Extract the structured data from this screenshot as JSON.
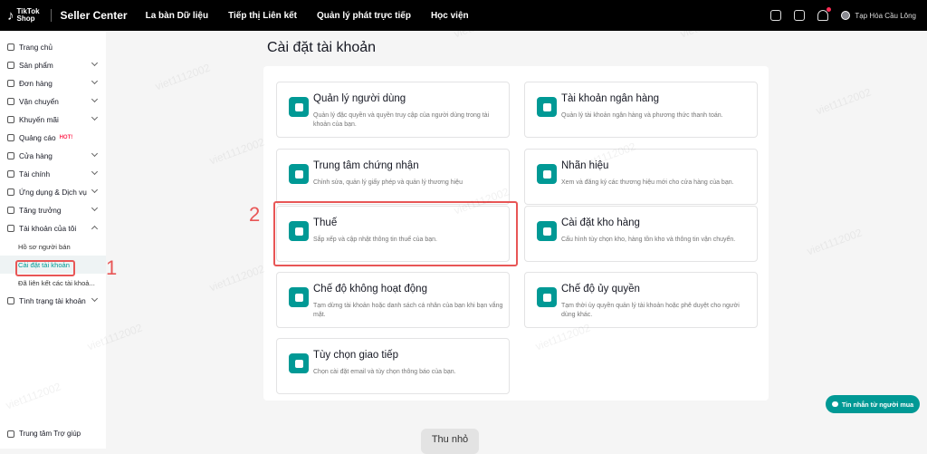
{
  "topbar": {
    "logo_line1": "TikTok",
    "logo_line2": "Shop",
    "seller_center": "Seller Center",
    "nav": [
      "La bàn Dữ liệu",
      "Tiếp thị Liên kết",
      "Quản lý phát trực tiếp",
      "Học viện"
    ],
    "user_name": "Tạp Hóa Cầu Lông"
  },
  "sidebar": {
    "items": [
      {
        "label": "Trang chủ",
        "icon": "home-icon"
      },
      {
        "label": "Sản phẩm",
        "icon": "product-icon"
      },
      {
        "label": "Đơn hàng",
        "icon": "order-icon"
      },
      {
        "label": "Vận chuyển",
        "icon": "shipping-icon"
      },
      {
        "label": "Khuyến mãi",
        "icon": "promotion-icon"
      },
      {
        "label": "Quảng cáo",
        "icon": "ads-icon",
        "badge": "HOT!"
      },
      {
        "label": "Cửa hàng",
        "icon": "store-icon"
      },
      {
        "label": "Tài chính",
        "icon": "finance-icon"
      },
      {
        "label": "Ứng dụng & Dịch vụ",
        "icon": "apps-icon"
      },
      {
        "label": "Tăng trưởng",
        "icon": "growth-icon"
      },
      {
        "label": "Tài khoản của tôi",
        "icon": "account-icon"
      }
    ],
    "subitems": [
      "Hồ sơ người bán",
      "Cài đặt tài khoản",
      "Đã liên kết các tài khoả..."
    ],
    "last_item": "Tình trạng tài khoản",
    "help": "Trung tâm Trợ giúp"
  },
  "page": {
    "title": "Cài đặt tài khoản"
  },
  "cards": [
    {
      "title": "Quản lý người dùng",
      "desc": "Quản lý đặc quyền và quyền truy cập của người dùng trong tài khoản của bạn.",
      "icon": "user-icon"
    },
    {
      "title": "Tài khoản ngân hàng",
      "desc": "Quản lý tài khoản ngân hàng và phương thức thanh toán.",
      "icon": "bank-card-icon"
    },
    {
      "title": "Trung tâm chứng nhận",
      "desc": "Chỉnh sửa, quản lý giấy phép và quản lý thương hiệu",
      "icon": "id-card-icon"
    },
    {
      "title": "Nhãn hiệu",
      "desc": "Xem và đăng ký các thương hiệu mới cho cửa hàng của bạn.",
      "icon": "brand-badge-icon"
    },
    {
      "title": "Thuế",
      "desc": "Sắp xếp và cập nhật thông tin thuế của bạn.",
      "icon": "tax-icon"
    },
    {
      "title": "Cài đặt kho hàng",
      "desc": "Cấu hình tùy chọn kho, hàng tồn kho và thông tin vận chuyển.",
      "icon": "warehouse-icon"
    },
    {
      "title": "Chế độ không hoạt động",
      "desc": "Tạm dừng tài khoản hoặc danh sách cá nhân của bạn khi bạn vắng mặt.",
      "icon": "store-pause-icon"
    },
    {
      "title": "Chế độ ủy quyền",
      "desc": "Tạm thời ủy quyền quản lý tài khoản hoặc phê duyệt cho người dùng khác.",
      "icon": "delegate-icon"
    },
    {
      "title": "Tùy chọn giao tiếp",
      "desc": "Chọn cài đặt email và tùy chọn thông báo của bạn.",
      "icon": "mail-icon"
    }
  ],
  "annotations": {
    "step1": "1",
    "step2": "2"
  },
  "chat_button": "Tin nhắn từ người mua",
  "collapse_button": "Thu nhỏ",
  "watermark": "viet1112002"
}
